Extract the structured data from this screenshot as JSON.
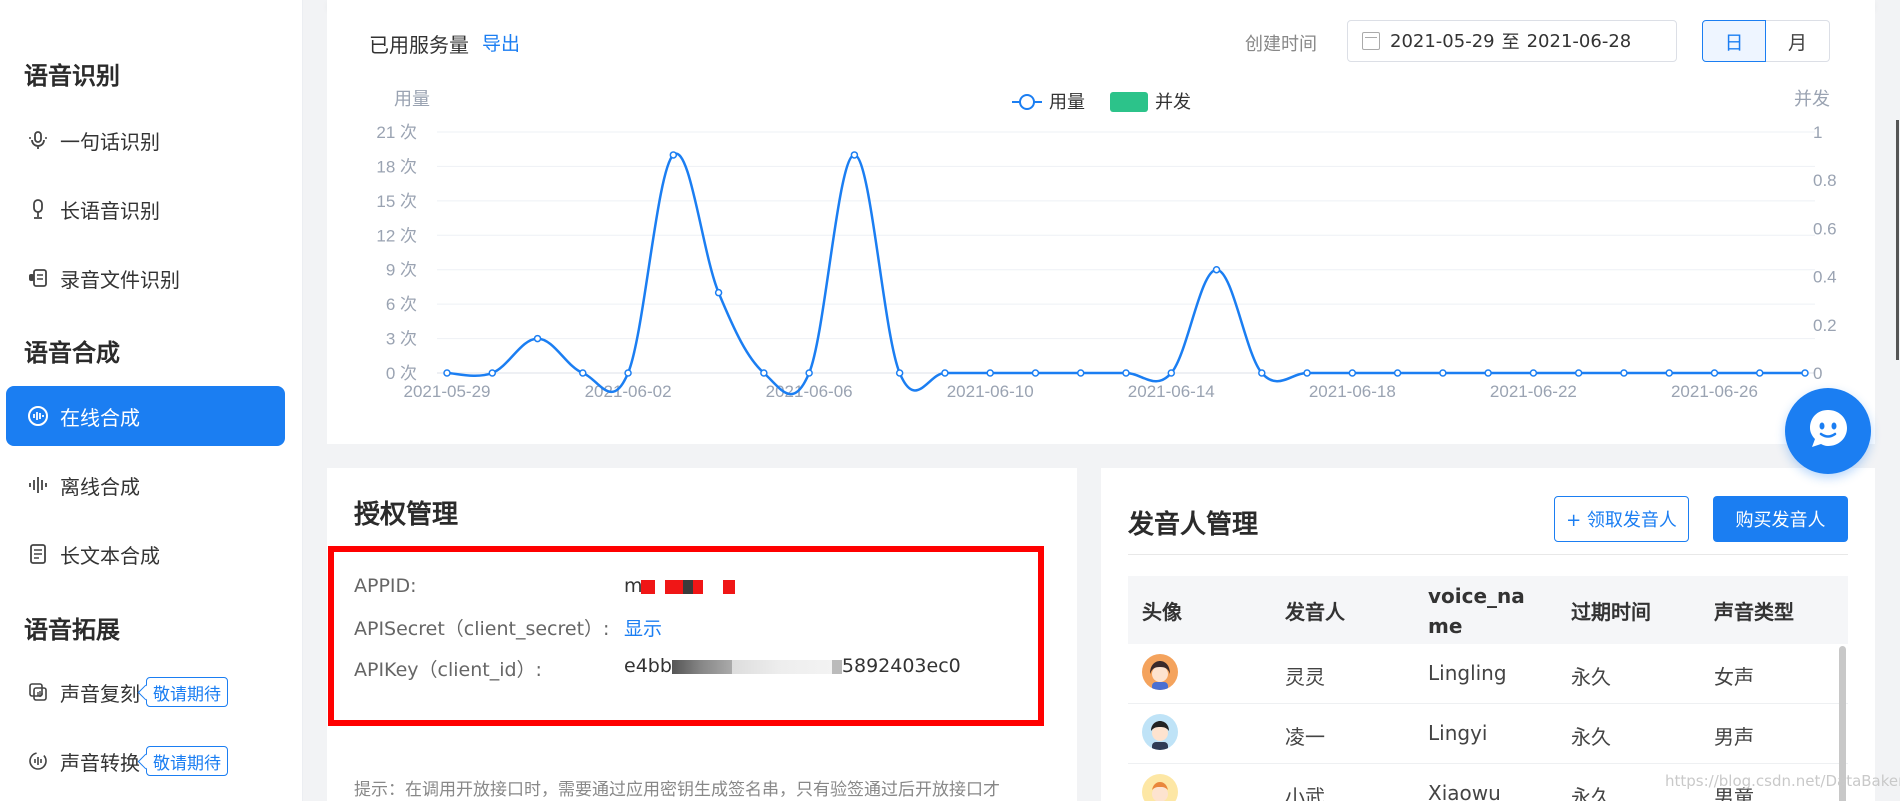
{
  "sidebar": {
    "sections": [
      {
        "title": "语音识别"
      },
      {
        "title": "语音合成"
      },
      {
        "title": "语音拓展"
      }
    ],
    "items": [
      {
        "label": "一句话识别",
        "icon": "microphone-icon"
      },
      {
        "label": "长语音识别",
        "icon": "mic-shield-icon"
      },
      {
        "label": "录音文件识别",
        "icon": "audio-file-icon"
      },
      {
        "label": "在线合成",
        "icon": "online-wave-icon",
        "active": true
      },
      {
        "label": "离线合成",
        "icon": "waveform-icon"
      },
      {
        "label": "长文本合成",
        "icon": "document-icon"
      },
      {
        "label": "声音复刻",
        "icon": "voice-clone-icon",
        "badge": "敬请期待"
      },
      {
        "label": "声音转换",
        "icon": "voice-convert-icon",
        "badge": "敬请期待"
      }
    ]
  },
  "usage": {
    "title": "已用服务量",
    "export_label": "导出",
    "created_label": "创建时间",
    "date_start": "2021-05-29",
    "date_sep": "至",
    "date_end": "2021-06-28",
    "granularity": {
      "day": "日",
      "month": "月",
      "selected": "日"
    }
  },
  "chart_data": {
    "type": "line",
    "legend": [
      "用量",
      "并发"
    ],
    "legend_position": "top-center",
    "ylabel_left": "用量",
    "ylabel_right": "并发",
    "y_left_ticks": [
      "0 次",
      "3 次",
      "6 次",
      "9 次",
      "12 次",
      "15 次",
      "18 次",
      "21 次"
    ],
    "y_right_ticks": [
      "0",
      "0.2",
      "0.4",
      "0.6",
      "0.8",
      "1"
    ],
    "ylim_left": [
      0,
      21
    ],
    "ylim_right": [
      0,
      1
    ],
    "x_tick_labels": [
      "2021-05-29",
      "2021-06-02",
      "2021-06-06",
      "2021-06-10",
      "2021-06-14",
      "2021-06-18",
      "2021-06-22",
      "2021-06-26"
    ],
    "x": [
      "2021-05-29",
      "2021-05-30",
      "2021-05-31",
      "2021-06-01",
      "2021-06-02",
      "2021-06-03",
      "2021-06-04",
      "2021-06-05",
      "2021-06-06",
      "2021-06-07",
      "2021-06-08",
      "2021-06-09",
      "2021-06-10",
      "2021-06-11",
      "2021-06-12",
      "2021-06-13",
      "2021-06-14",
      "2021-06-15",
      "2021-06-16",
      "2021-06-17",
      "2021-06-18",
      "2021-06-19",
      "2021-06-20",
      "2021-06-21",
      "2021-06-22",
      "2021-06-23",
      "2021-06-24",
      "2021-06-25",
      "2021-06-26",
      "2021-06-27",
      "2021-06-28"
    ],
    "series": [
      {
        "name": "用量",
        "values": [
          0,
          0,
          3,
          0,
          0,
          19,
          7,
          0,
          0,
          19,
          0,
          0,
          0,
          0,
          0,
          0,
          0,
          9,
          0,
          0,
          0,
          0,
          0,
          0,
          0,
          0,
          0,
          0,
          0,
          0,
          0
        ],
        "color": "#1b7ef2"
      },
      {
        "name": "并发",
        "values": [],
        "color": "#2cc38a"
      }
    ],
    "grid": true
  },
  "auth": {
    "title": "授权管理",
    "appid_label": "APPID:",
    "appid_value": "m",
    "secret_label": "APISecret（client_secret）:",
    "secret_link": "显示",
    "key_label": "APIKey（client_id）:",
    "key_value_start": "e4bb",
    "key_value_end": "5892403ec0",
    "hint": "提示：在调用开放接口时，需要通过应用密钥生成签名串，只有验签通过后开放接口才"
  },
  "speakers": {
    "title": "发音人管理",
    "claim_button": "+ 领取发音人",
    "buy_button": "购买发音人",
    "columns": [
      "头像",
      "发音人",
      "voice_name",
      "过期时间",
      "声音类型"
    ],
    "rows": [
      {
        "name": "灵灵",
        "voice": "Lingling",
        "expiry": "永久",
        "type": "女声"
      },
      {
        "name": "凌一",
        "voice": "Lingyi",
        "expiry": "永久",
        "type": "男声"
      },
      {
        "name": "小武",
        "voice": "Xiaowu",
        "expiry": "永久",
        "type": "男童"
      }
    ]
  },
  "watermark": "https://blog.csdn.net/DataBaker",
  "colors": {
    "accent": "#1b7ef2",
    "concurrency": "#2cc38a",
    "highlight_box": "#ff0000"
  }
}
